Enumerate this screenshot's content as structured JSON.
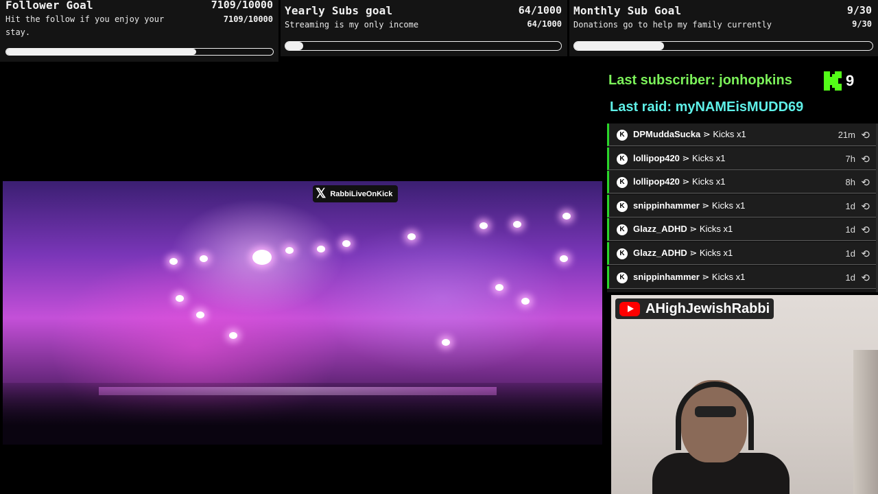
{
  "goals": [
    {
      "title": "Follower Goal",
      "count": "7109/10000",
      "desc": "Hit the follow if you enjoy your stay.",
      "small_count": "7109/10000",
      "progress": 0.711
    },
    {
      "title": "Yearly Subs goal",
      "count": "64/1000",
      "desc": "Streaming is my only income",
      "small_count": "64/1000",
      "progress": 0.064
    },
    {
      "title": "Monthly Sub Goal",
      "count": "9/30",
      "desc": "Donations go to help my family currently",
      "small_count": "9/30",
      "progress": 0.3
    }
  ],
  "last_subscriber": "Last subscriber: jonhopkins",
  "kick_badge_count": "9",
  "last_raid": "Last raid: myNAMEisMUDD69",
  "events": [
    {
      "user": "DPMuddaSucka",
      "action": "Kicks x1",
      "time": "21m"
    },
    {
      "user": "lollipop420",
      "action": "Kicks x1",
      "time": "7h"
    },
    {
      "user": "lollipop420",
      "action": "Kicks x1",
      "time": "8h"
    },
    {
      "user": "snippinhammer",
      "action": "Kicks x1",
      "time": "1d"
    },
    {
      "user": "Glazz_ADHD",
      "action": "Kicks x1",
      "time": "1d"
    },
    {
      "user": "Glazz_ADHD",
      "action": "Kicks x1",
      "time": "1d"
    },
    {
      "user": "snippinhammer",
      "action": "Kicks x1",
      "time": "1d"
    }
  ],
  "event_icon_letter": "K",
  "event_separator": " ⋗ ",
  "video_watermark": "RabbiLiveOnKick",
  "x_icon_glyph": "𝕏",
  "webcam_channel": "AHighJewishRabbi",
  "colors": {
    "last_sub": "#7cf25a",
    "last_raid": "#5ff0e8",
    "kick_green": "#53fc18",
    "youtube_red": "#ff0000"
  }
}
